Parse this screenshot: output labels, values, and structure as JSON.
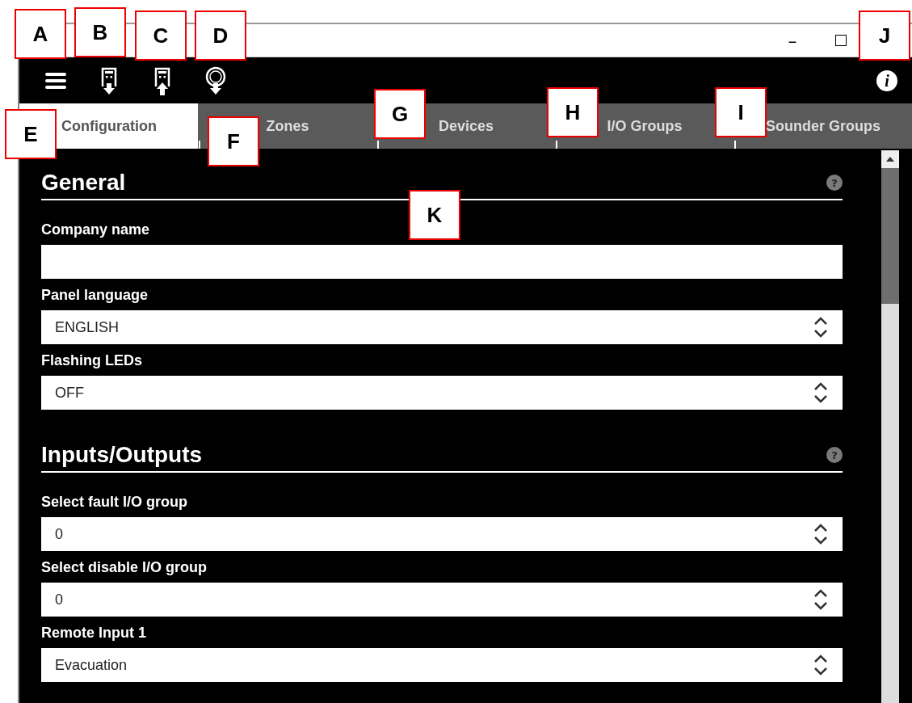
{
  "window": {
    "minimize_symbol": "–"
  },
  "toolbar": {
    "info_symbol": "i"
  },
  "tabs": [
    {
      "label": "Configuration",
      "selected": true
    },
    {
      "label": "Zones",
      "selected": false
    },
    {
      "label": "Devices",
      "selected": false
    },
    {
      "label": "I/O Groups",
      "selected": false
    },
    {
      "label": "Sounder Groups",
      "selected": false
    }
  ],
  "sections": [
    {
      "title": "General",
      "help": "?",
      "fields": [
        {
          "label": "Company name",
          "kind": "text"
        },
        {
          "label": "Panel language",
          "kind": "select",
          "value": "ENGLISH"
        },
        {
          "label": "Flashing LEDs",
          "kind": "select",
          "value": "OFF"
        }
      ]
    },
    {
      "title": "Inputs/Outputs",
      "help": "?",
      "fields": [
        {
          "label": "Select fault I/O group",
          "kind": "select",
          "value": "0"
        },
        {
          "label": "Select disable I/O group",
          "kind": "select",
          "value": "0"
        },
        {
          "label": "Remote Input 1",
          "kind": "select",
          "value": "Evacuation"
        }
      ]
    }
  ],
  "callouts": [
    "A",
    "B",
    "C",
    "D",
    "J",
    "E",
    "F",
    "G",
    "H",
    "I",
    "K"
  ]
}
